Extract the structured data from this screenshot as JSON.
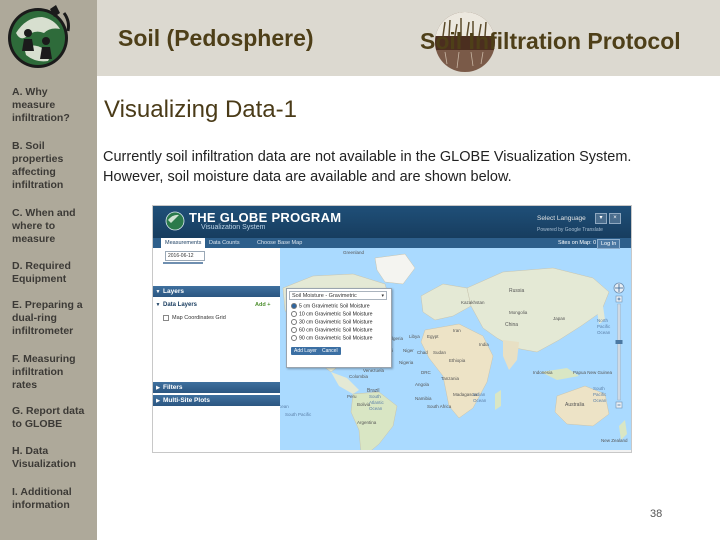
{
  "header": {
    "left_title": "Soil (Pedosphere)",
    "right_title": "Soil Infiltration Protocol"
  },
  "sidebar": {
    "items": [
      {
        "label": "A. Why measure infiltration?"
      },
      {
        "label": "B. Soil properties affecting infiltration"
      },
      {
        "label": "C. When and where to measure"
      },
      {
        "label": "D. Required Equipment"
      },
      {
        "label": "E. Preparing a dual-ring infiltrometer"
      },
      {
        "label": "F. Measuring infiltration rates"
      },
      {
        "label": "G. Report data to GLOBE"
      },
      {
        "label": "H. Data Visualization"
      },
      {
        "label": "I. Additional information"
      }
    ]
  },
  "slide": {
    "title": "Visualizing Data-1",
    "body": "Currently soil infiltration data are not available in the GLOBE Visualization System. However, soil moisture data are available and are shown below.",
    "page_number": "38"
  },
  "globe_ui": {
    "brand": "THE GLOBE PROGRAM",
    "subtitle": "Visualization System",
    "select_language": "Select Language",
    "powered_by": "Powered by Google Translate",
    "tabs": [
      "Measurements",
      "Data Counts",
      "Choose Base Map"
    ],
    "sites_on_map": "Sites on Map: 0",
    "login": "Log In",
    "date": "2016-06-12",
    "layers_header": "Layers",
    "data_layers": "Data Layers",
    "add": "Add +",
    "map_coordinates": "Map Coordinates Grid",
    "filters": "Filters",
    "multi_site_plots": "Multi-Site Plots",
    "dropdown_selected": "Soil Moisture - Gravimetric",
    "options": [
      "5 cm Gravimetric Soil Moisture",
      "10 cm Gravimetric Soil Moisture",
      "30 cm Gravimetric Soil Moisture",
      "60 cm Gravimetric Soil Moisture",
      "90 cm Gravimetric Soil Moisture"
    ],
    "add_layer": "Add Layer",
    "cancel": "Cancel",
    "map_labels": {
      "greenland": "Greenland",
      "russia": "Russia",
      "mongolia": "Mongolia",
      "china": "China",
      "india": "India",
      "japan": "Japan",
      "kazakhstan": "Kazakhstan",
      "iran": "Iran",
      "algeria": "Algeria",
      "libya": "Libya",
      "egypt": "Egypt",
      "mali": "Mali",
      "niger": "Niger",
      "chad": "Chad",
      "sudan": "Sudan",
      "ethiopia": "Ethiopia",
      "nigeria": "Nigeria",
      "drc": "DRC",
      "angola": "Angola",
      "tanzania": "Tanzania",
      "namibia": "Namibia",
      "south_africa": "South Africa",
      "madagascar": "Madagascar",
      "brazil": "Brazil",
      "peru": "Peru",
      "bolivia": "Bolivia",
      "argentina": "Argentina",
      "colombia": "Colombia",
      "venezuela": "Venezuela",
      "mexico": "Mexico",
      "indonesia": "Indonesia",
      "papua_new_guinea": "Papua New Guinea",
      "australia": "Australia",
      "new_zealand": "New Zealand",
      "north_pacific_ocean": "North Pacific Ocean",
      "south_pacific_ocean": "South Pacific Ocean",
      "pacific_ocean": "Pacific Ocean",
      "south_atlantic_ocean": "South Atlantic Ocean",
      "indian_ocean": "Indian Ocean",
      "south_pacific": "South Pacific"
    }
  },
  "colors": {
    "sidebar": "#aea99a",
    "header": "#dcd9d0",
    "title_brown": "#4e3f18",
    "ocean": "#aadaff",
    "land": "#e4e9d5",
    "globe_blue": "#1f4f78"
  }
}
